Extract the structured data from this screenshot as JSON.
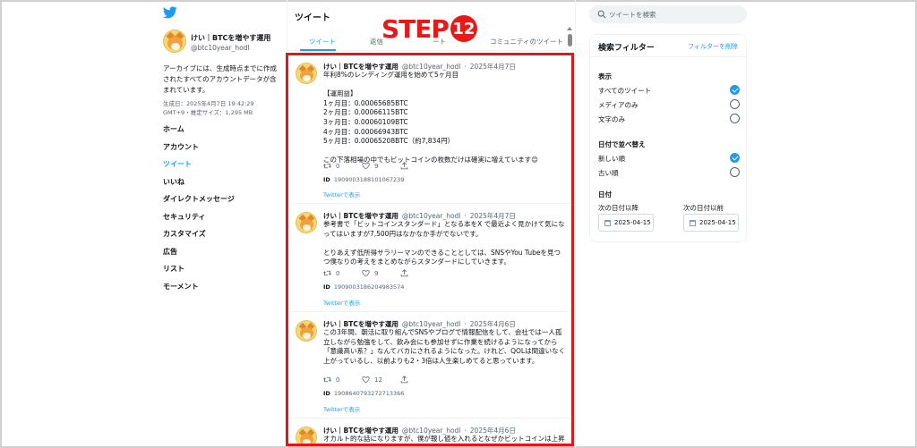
{
  "sidebar": {
    "account_name": "けい｜BTCを増やす運用",
    "account_handle": "@btc10year_hodl",
    "archive_note": "アーカイブには、生成時点までに作成されたすべてのアカウントデータが含まれています。",
    "generated": "生成日：2025年4月7日 19:42:29 GMT+9・推定サイズ：1,295 MB",
    "nav": [
      "ホーム",
      "アカウント",
      "ツイート",
      "いいね",
      "ダイレクトメッセージ",
      "セキュリティ",
      "カスタマイズ",
      "広告",
      "リスト",
      "モーメント"
    ],
    "active_nav": "ツイート"
  },
  "center": {
    "title": "ツイート",
    "tabs": [
      "ツイート",
      "返信",
      "リツイート",
      "コミュニティのツイート"
    ],
    "tabs_visible": [
      "ツイート",
      "返信",
      "ート",
      "コミュニティのツイート"
    ],
    "active_tab": "ツイート"
  },
  "step": {
    "text": "STEP",
    "number": "12"
  },
  "tweets": [
    {
      "name": "けい｜BTCを増やす運用",
      "handle": "@btc10year_hodl",
      "date": "2025年4月7日",
      "body": "年利8%のレンディング運用を始めて5ヶ月目\n\n【運用益】\n1ヶ月目：0.00065685BTC\n2ヶ月目：0.00066115BTC\n3ヶ月目：0.00060109BTC\n4ヶ月目：0.00066943BTC\n5ヶ月目：0.00065208BTC（約7,834円）\n\nこの下落相場の中でもビットコインの枚数だけは確実に増えています😊",
      "retweets": "0",
      "likes": "9",
      "id_label": "ID",
      "id": "1909003188101067239",
      "link": "Twitterで表示"
    },
    {
      "name": "けい｜BTCを増やす運用",
      "handle": "@btc10year_hodl",
      "date": "2025年4月7日",
      "body": "参考書で「ビットコインスタンダード」となる本をX で最近よく見かけて気になってはいますが7,500円はなかなか手がでないです。\n\nとりあえず低所得サラリーマンのできることとしては、SNSやYou Tubeを見つつ僕なりの考えをまとめながらスタンダードにしていきます。",
      "retweets": "0",
      "likes": "9",
      "id_label": "ID",
      "id": "1909003186204983574",
      "link": "Twitterで表示"
    },
    {
      "name": "けい｜BTCを増やす運用",
      "handle": "@btc10year_hodl",
      "date": "2025年4月6日",
      "body": "この3年間、朝活に取り組んでSNSやブログで情報配信をして、会社では一人孤立しながら勉強をして、飲み会にも参加せずに作業を続けるようになってから「意識高い系？」なんてバカにされるようになった。けれど、QOLは間違いなく上がっているし、以前よりも2・3倍は人生楽しめてると思っています。",
      "retweets": "0",
      "likes": "12",
      "id_label": "ID",
      "id": "1908640793272713366",
      "link": "Twitterで表示"
    },
    {
      "name": "けい｜BTCを増やす運用",
      "handle": "@btc10year_hodl",
      "date": "2025年4月6日",
      "body": "オカルト的な話になりますが、僕が報し値を入れるとなぜかビットコインは上昇します。会社の昼休み時に数ドル下がりだしたところを買えます。"
    }
  ],
  "filters": {
    "search_placeholder": "ツイートを検索",
    "title": "検索フィルター",
    "clear": "フィルターを削除",
    "display_title": "表示",
    "display_options": [
      "すべてのツイート",
      "メディアのみ",
      "文字のみ"
    ],
    "display_selected": "すべてのツイート",
    "sort_title": "日付で並べ替え",
    "sort_options": [
      "新しい順",
      "古い順"
    ],
    "sort_selected": "新しい順",
    "date_title": "日付",
    "from_label": "次の日付以降",
    "to_label": "次の日付以前",
    "from_value": "2025-04-15",
    "to_value": "2025-04-15"
  }
}
